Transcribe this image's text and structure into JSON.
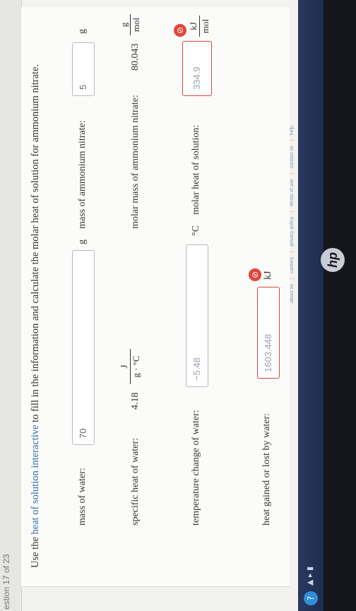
{
  "header": {
    "fragment": "estion 17 of 23"
  },
  "instructions": {
    "prefix": "Use the ",
    "link": "heat of solution interactive",
    "suffix": " to fill in the information and calculate the molar heat of solution for ammonium nitrate."
  },
  "fields": {
    "mass_water": {
      "label": "mass of water:",
      "value": "70",
      "unit": "g"
    },
    "mass_ammonium_nitrate": {
      "label": "mass of ammonium nitrate:",
      "value": "5",
      "unit": "g"
    },
    "specific_heat": {
      "label": "specific heat of water:",
      "value": "4.18",
      "unit_num": "J",
      "unit_den": "g · °C"
    },
    "molar_mass": {
      "label": "molar mass of ammonium nitrate:",
      "value": "80.043",
      "unit_num": "g",
      "unit_den": "mol"
    },
    "temp_change": {
      "label": "temperature change of water:",
      "value": "−5.48",
      "unit": "°C"
    },
    "molar_heat": {
      "label": "molar heat of solution:",
      "value": "334.9",
      "unit_num": "kJ",
      "unit_den": "mol"
    },
    "heat_gained": {
      "label": "heat gained or lost by water:",
      "value": "1603.448",
      "unit": "kJ"
    }
  },
  "error_badge": "⊘",
  "footer": {
    "links": [
      "about us",
      "careers",
      "privacy policy",
      "terms of use",
      "contact us",
      "help"
    ]
  },
  "taskbar": {
    "help": "?",
    "tray": "▲ ▸ ▮"
  },
  "brand": "hp",
  "colors": {
    "link": "#2f6fb3",
    "error": "#e0463a",
    "taskbar": "#1f2c4d"
  }
}
